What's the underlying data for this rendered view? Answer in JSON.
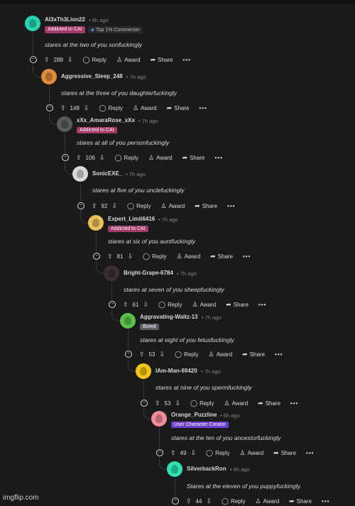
{
  "actions": {
    "reply": "Reply",
    "award": "Award",
    "share": "Share",
    "more": "•••"
  },
  "watermark": "imgflip.com",
  "comments": [
    {
      "user": "Al3xTh3Lion22",
      "time": "• 8h ago",
      "flairs": [
        "Addicted to CAI",
        "Top 1% Commenter"
      ],
      "text": "stares at the two of you sonfuckingly",
      "votes": "288",
      "avatar_color": "#29d3b0"
    },
    {
      "user": "Aggressive_Sleep_248",
      "time": "• 7h ago",
      "flairs": [],
      "text": "stares at the three of you daughterfuckingly",
      "votes": "148",
      "avatar_color": "#e08a3c"
    },
    {
      "user": "xXx_AmaraRose_xXx",
      "time": "• 7h ago",
      "flairs": [
        "Addicted to CAI"
      ],
      "text": "stares at all of you personfuckingly",
      "votes": "106",
      "avatar_color": "#5a5a5a"
    },
    {
      "user": "SonicEXE_",
      "time": "• 7h ago",
      "flairs": [],
      "text": "stares at five of you unclefuckingly",
      "votes": "92",
      "avatar_color": "#d8d8d8"
    },
    {
      "user": "Expert_Limit6416",
      "time": "• 7h ago",
      "flairs": [
        "Addicted to CAI"
      ],
      "text": "stares at six of you auntfuckingly",
      "votes": "81",
      "avatar_color": "#e8c15a"
    },
    {
      "user": "Bright-Grape-6784",
      "time": "• 7h ago",
      "flairs": [],
      "text": "stares at seven of you sheepfuckingly",
      "votes": "61",
      "avatar_color": "#3a2f35"
    },
    {
      "user": "Aggravating-Waltz-13",
      "time": "• 7h ago",
      "flairs": [
        "Bored"
      ],
      "text": "stares at eight of you fetusfuckingly",
      "votes": "53",
      "avatar_color": "#5cc04a"
    },
    {
      "user": "IAm-Man-69420",
      "time": "• 7h ago",
      "flairs": [],
      "text": "stares at nine of you spermfuckingly",
      "votes": "53",
      "avatar_color": "#f0c419"
    },
    {
      "user": "Orange_Puzzline",
      "time": "• 6h ago",
      "flairs": [
        "User Character Creator"
      ],
      "text": "stares at the ten of you ancestorfuckingly",
      "votes": "49",
      "avatar_color": "#f28b9a"
    },
    {
      "user": "SilverbackRon",
      "time": "• 6h ago",
      "flairs": [],
      "text": "Stares at the eleven of you puppyfuckingly.",
      "votes": "44",
      "avatar_color": "#2fe0b0"
    }
  ],
  "colors": {
    "cai_flair": "#a33a6a",
    "commenter_flair": "#2a2a2e",
    "bored_flair": "#5a5f66",
    "creator_flair": "#6a3fd0"
  }
}
